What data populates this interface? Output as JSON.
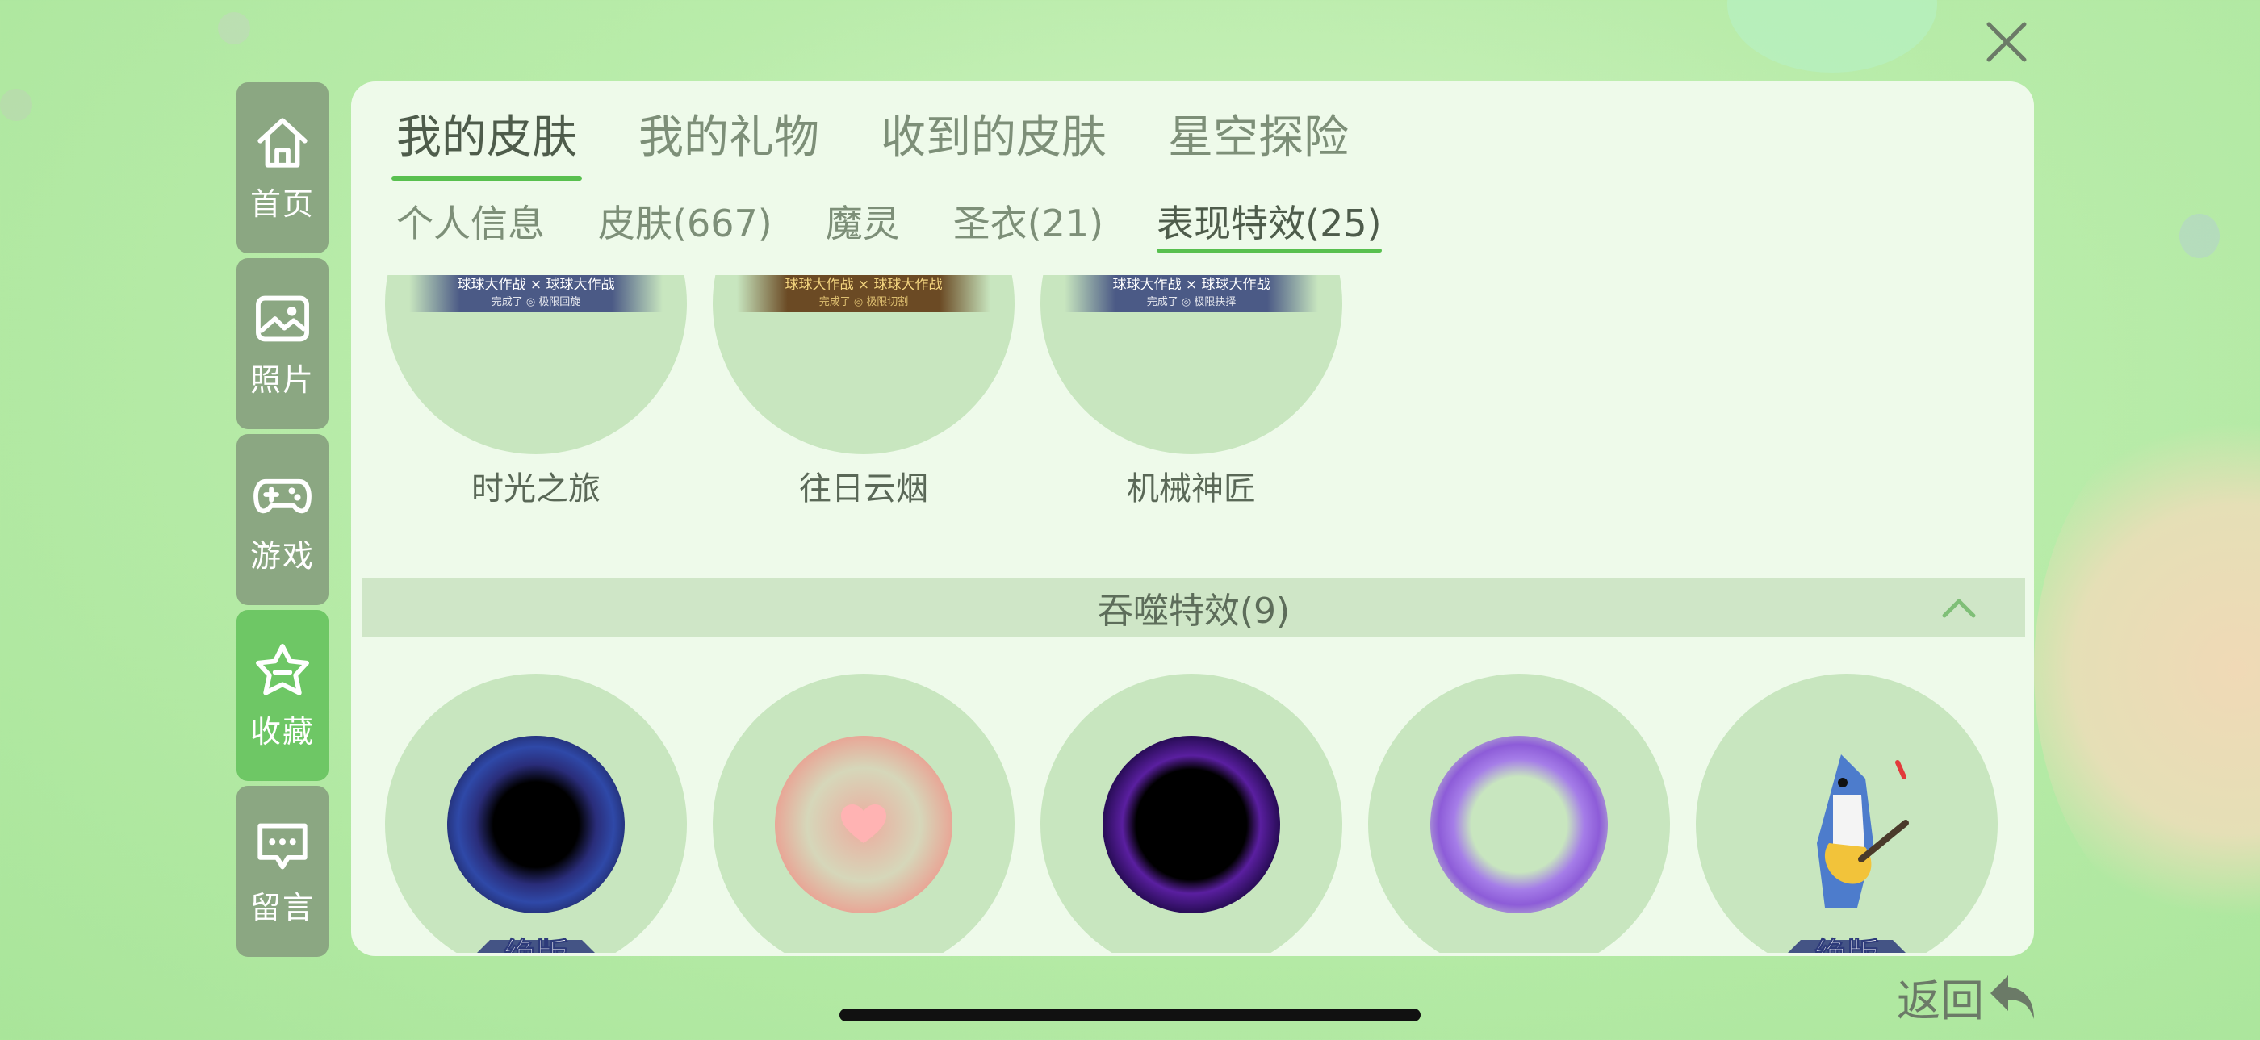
{
  "sidebar": {
    "items": [
      {
        "label": "首页",
        "icon": "home-icon"
      },
      {
        "label": "照片",
        "icon": "photo-icon"
      },
      {
        "label": "游戏",
        "icon": "gamepad-icon"
      },
      {
        "label": "收藏",
        "icon": "star-icon",
        "active": true
      },
      {
        "label": "留言",
        "icon": "message-icon"
      }
    ]
  },
  "tabs": [
    "我的皮肤",
    "我的礼物",
    "收到的皮肤",
    "星空探险"
  ],
  "active_tab": "我的皮肤",
  "subtabs": [
    "个人信息",
    "皮肤(667)",
    "魔灵",
    "圣衣(21)",
    "表现特效(25)"
  ],
  "active_subtab": "表现特效(25)",
  "top_items": [
    {
      "name": "时光之旅",
      "tag_line1": "球球大作战 × 球球大作战",
      "tag_line2": "完成了 ◎ 极限回旋"
    },
    {
      "name": "往日云烟",
      "tag_line1": "球球大作战 × 球球大作战",
      "tag_line2": "完成了 ◎ 极限切割"
    },
    {
      "name": "机械神匠",
      "tag_line1": "球球大作战 × 球球大作战",
      "tag_line2": "完成了 ◎ 极限抉择"
    }
  ],
  "section": {
    "title": "吞噬特效(9)",
    "expanded": true
  },
  "effect_items": [
    {
      "effect": "blue-void-vortex",
      "badge": "绝版"
    },
    {
      "effect": "pink-heart-ring",
      "badge": ""
    },
    {
      "effect": "purple-void-vortex",
      "badge": ""
    },
    {
      "effect": "purple-crystal-ring",
      "badge": ""
    },
    {
      "effect": "shark-guitarist",
      "badge": "绝版"
    }
  ],
  "back": {
    "label": "返回"
  },
  "colors": {
    "accent": "#58c04f",
    "sidebar": "#8ba782",
    "sidebar_active": "#6ec765"
  }
}
